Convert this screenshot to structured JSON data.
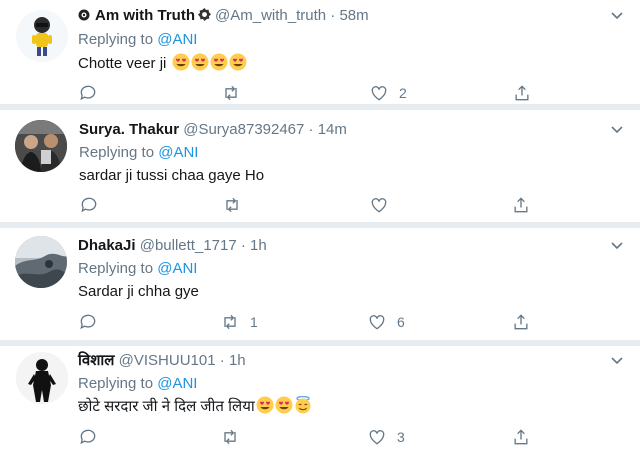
{
  "tweets": [
    {
      "name": "Am with Truth",
      "handle": "@Am_with_truth",
      "time": "58m",
      "replying_prefix": "Replying to",
      "replying_to": "@ANI",
      "text": "Chotte veer ji",
      "emojis": [
        "heart-eyes",
        "heart-eyes",
        "heart-eyes",
        "heart-eyes"
      ],
      "replies": "",
      "retweets": "",
      "likes": "2"
    },
    {
      "name": "Surya. Thakur",
      "handle": "@Surya87392467",
      "time": "14m",
      "replying_prefix": "Replying to",
      "replying_to": "@ANI",
      "text": "sardar ji tussi chaa gaye Ho",
      "emojis": [],
      "replies": "",
      "retweets": "",
      "likes": ""
    },
    {
      "name": "DhakaJi",
      "handle": "@bullett_1717",
      "time": "1h",
      "replying_prefix": "Replying to",
      "replying_to": "@ANI",
      "text": "Sardar ji chha gye",
      "emojis": [],
      "replies": "",
      "retweets": "1",
      "likes": "6"
    },
    {
      "name": "विशाल",
      "handle": "@VISHUU101",
      "time": "1h",
      "replying_prefix": "Replying to",
      "replying_to": "@ANI",
      "text": "छोटे सरदार जी ने दिल जीत लिया",
      "emojis": [
        "heart-eyes",
        "heart-eyes",
        "smiling-halo"
      ],
      "replies": "",
      "retweets": "",
      "likes": "3"
    }
  ],
  "separator_dot": "·",
  "colors": {
    "link": "#1b95e0",
    "muted": "#657786",
    "separator": "#e6ecf0"
  }
}
